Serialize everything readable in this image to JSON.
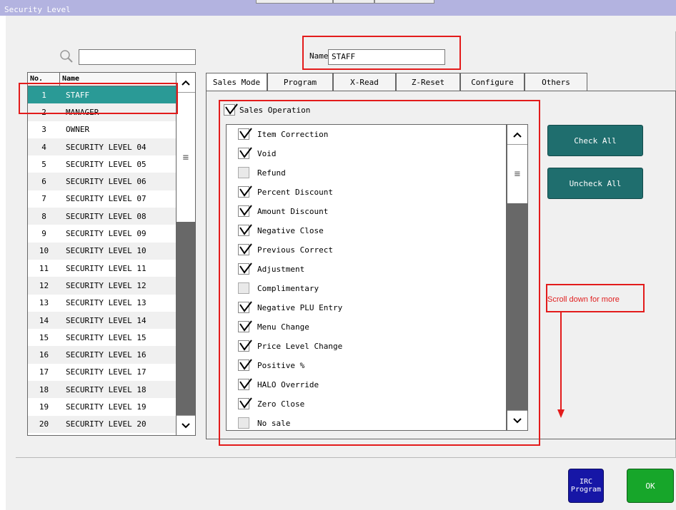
{
  "window": {
    "title": "Security Level"
  },
  "search": {
    "value": ""
  },
  "name_field": {
    "label": "Name",
    "value": "STAFF"
  },
  "list": {
    "headers": {
      "no": "No.",
      "name": "Name"
    },
    "rows": [
      {
        "no": "1",
        "name": "STAFF"
      },
      {
        "no": "2",
        "name": "MANAGER"
      },
      {
        "no": "3",
        "name": "OWNER"
      },
      {
        "no": "4",
        "name": "SECURITY LEVEL 04"
      },
      {
        "no": "5",
        "name": "SECURITY LEVEL 05"
      },
      {
        "no": "6",
        "name": "SECURITY LEVEL 06"
      },
      {
        "no": "7",
        "name": "SECURITY LEVEL 07"
      },
      {
        "no": "8",
        "name": "SECURITY LEVEL 08"
      },
      {
        "no": "9",
        "name": "SECURITY LEVEL 09"
      },
      {
        "no": "10",
        "name": "SECURITY LEVEL 10"
      },
      {
        "no": "11",
        "name": "SECURITY LEVEL 11"
      },
      {
        "no": "12",
        "name": "SECURITY LEVEL 12"
      },
      {
        "no": "13",
        "name": "SECURITY LEVEL 13"
      },
      {
        "no": "14",
        "name": "SECURITY LEVEL 14"
      },
      {
        "no": "15",
        "name": "SECURITY LEVEL 15"
      },
      {
        "no": "16",
        "name": "SECURITY LEVEL 16"
      },
      {
        "no": "17",
        "name": "SECURITY LEVEL 17"
      },
      {
        "no": "18",
        "name": "SECURITY LEVEL 18"
      },
      {
        "no": "19",
        "name": "SECURITY LEVEL 19"
      },
      {
        "no": "20",
        "name": "SECURITY LEVEL 20"
      }
    ]
  },
  "tabs": [
    {
      "label": "Sales Mode"
    },
    {
      "label": "Program"
    },
    {
      "label": "X-Read"
    },
    {
      "label": "Z-Reset"
    },
    {
      "label": "Configure"
    },
    {
      "label": "Others"
    }
  ],
  "sales_operation": {
    "label": "Sales Operation",
    "checked": true
  },
  "permissions": [
    {
      "label": "Item Correction",
      "checked": true
    },
    {
      "label": "Void",
      "checked": true
    },
    {
      "label": "Refund",
      "checked": false
    },
    {
      "label": "Percent Discount",
      "checked": true
    },
    {
      "label": "Amount Discount",
      "checked": true
    },
    {
      "label": "Negative Close",
      "checked": true
    },
    {
      "label": "Previous Correct",
      "checked": true
    },
    {
      "label": "Adjustment",
      "checked": true
    },
    {
      "label": "Complimentary",
      "checked": false
    },
    {
      "label": "Negative PLU Entry",
      "checked": true
    },
    {
      "label": "Menu Change",
      "checked": true
    },
    {
      "label": "Price Level Change",
      "checked": true
    },
    {
      "label": "Positive %",
      "checked": true
    },
    {
      "label": "HALO Override",
      "checked": true
    },
    {
      "label": "Zero Close",
      "checked": true
    },
    {
      "label": "No sale",
      "checked": false
    }
  ],
  "buttons": {
    "check_all": "Check All",
    "uncheck_all": "Uncheck All",
    "irc_line1": "IRC",
    "irc_line2": "Program",
    "ok": "OK"
  },
  "annotation": {
    "scroll_note": "Scroll down for more"
  },
  "colors": {
    "titlebar": "#b3b3e0",
    "selection": "#2a9a96",
    "teal_button": "#1f6e6e",
    "irc_button": "#1616a6",
    "ok_button": "#17a62a",
    "highlight": "#e31b1b"
  }
}
